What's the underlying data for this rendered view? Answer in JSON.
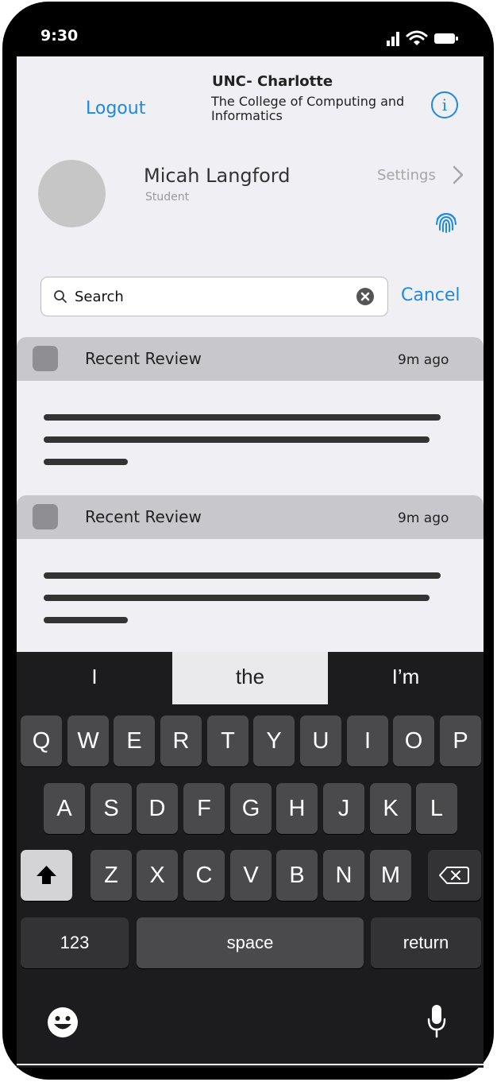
{
  "status_bar": {
    "time": "9:30"
  },
  "header": {
    "logout_label": "Logout",
    "org_title": "UNC- Charlotte",
    "org_subtitle": "The College of Computing and Informatics",
    "info_label": "i"
  },
  "profile": {
    "name": "Micah Langford",
    "role": "Student",
    "settings_label": "Settings"
  },
  "search": {
    "value": "Search",
    "cancel_label": "Cancel"
  },
  "cards": [
    {
      "title": "Recent Review",
      "time": "9m ago"
    },
    {
      "title": "Recent Review",
      "time": "9m ago"
    }
  ],
  "keyboard": {
    "suggestions": [
      "I",
      "the",
      "I’m"
    ],
    "row1": [
      "Q",
      "W",
      "E",
      "R",
      "T",
      "Y",
      "U",
      "I",
      "O",
      "P"
    ],
    "row2": [
      "A",
      "S",
      "D",
      "F",
      "G",
      "H",
      "J",
      "K",
      "L"
    ],
    "row3": [
      "Z",
      "X",
      "C",
      "V",
      "B",
      "N",
      "M"
    ],
    "numbers_label": "123",
    "space_label": "space",
    "return_label": "return"
  },
  "colors": {
    "accent": "#1e88e5",
    "screen_bg": "#efeff4",
    "keyboard_bg": "#1c1c1e"
  }
}
